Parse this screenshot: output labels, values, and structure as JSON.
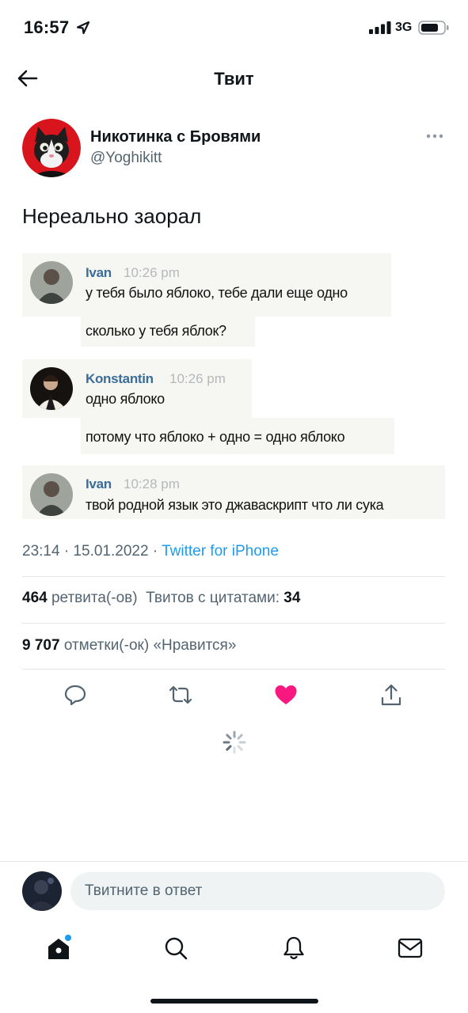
{
  "status_bar": {
    "time": "16:57",
    "network": "3G"
  },
  "header": {
    "title": "Твит"
  },
  "tweet": {
    "author_name": "Никотинка с Бровями",
    "author_handle": "@Yoghikitt",
    "text": "Нереально заорал",
    "timestamp": "23:14 · 15.01.2022 · ",
    "source": "Twitter for iPhone"
  },
  "embedded_chat": {
    "messages": [
      {
        "name": "Ivan",
        "time": "10:26 pm",
        "lines": [
          "у тебя было яблоко, тебе дали еще одно",
          "сколько у тебя яблок?"
        ]
      },
      {
        "name": "Konstantin",
        "time": "10:26 pm",
        "lines": [
          "одно яблоко",
          "потому что яблоко + одно = одно яблоко"
        ]
      },
      {
        "name": "Ivan",
        "time": "10:28 pm",
        "lines": [
          "твой родной язык это джаваскрипт что ли сука"
        ]
      }
    ]
  },
  "stats": {
    "retweets_count": "464",
    "retweets_label": " ретвита(-ов)  Твитов с цитатами: ",
    "quotes_count": "34",
    "likes_count": "9 707",
    "likes_label": " отметки(-ок) «Нравится»"
  },
  "actions": [
    "reply-icon",
    "retweet-icon",
    "heart-icon",
    "share-icon"
  ],
  "reply": {
    "placeholder": "Твитните в ответ"
  },
  "tabs": [
    "home-icon",
    "search-icon",
    "bell-icon",
    "mail-icon"
  ],
  "colors": {
    "accent": "#1d9bf0",
    "like": "#f91880",
    "text": "#0f1419",
    "secondary": "#536471",
    "chat_name": "#3a6d99"
  }
}
